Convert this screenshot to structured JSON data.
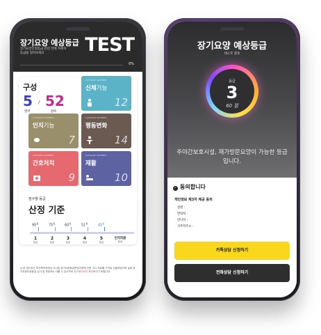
{
  "left": {
    "status_text": "9:41 KST",
    "header": {
      "title": "장기요양 예상등급",
      "description": "장기요양인정등급 관련 전에 자세히 등급을 알아보세요",
      "test_badge": "TEST",
      "progress": 0,
      "progress_label": "0%"
    },
    "composition": {
      "title": "구성",
      "count_a": "5",
      "count_a_label": "영역",
      "separator": "/",
      "count_b": "52",
      "count_b_label": "항목"
    },
    "tiles": [
      {
        "small": "CATEGORY NUMBER",
        "label_bold": "신체",
        "label_rest": "기능",
        "count": "12",
        "icon": "person-icon"
      },
      {
        "small": "CATEGORY NUMBER",
        "label_bold": "인지",
        "label_rest": "기능",
        "count": "7",
        "icon": "brain-icon"
      },
      {
        "small": "CATEGORY NUMBER",
        "label_bold": "행동변화",
        "label_rest": "",
        "count": "14",
        "icon": "activity-icon"
      },
      {
        "small": "CATEGORY NUMBER",
        "label_bold": "간호처치",
        "label_rest": "",
        "count": "9",
        "icon": "medical-kit-icon"
      },
      {
        "small": "CATEGORY NUMBER",
        "label_bold": "재활",
        "label_rest": "",
        "count": "10",
        "icon": "rehab-icon"
      }
    ],
    "criteria": {
      "small_label": "점수별 등급",
      "title": "산정 기준",
      "thresholds": [
        {
          "value": "95",
          "unit": "점"
        },
        {
          "value": "75",
          "unit": "점"
        },
        {
          "value": "60",
          "unit": "점"
        },
        {
          "value": "51",
          "unit": "점"
        },
        {
          "value": "45",
          "unit": "점"
        }
      ],
      "grades": [
        {
          "num": "1",
          "unit": "등급"
        },
        {
          "num": "2",
          "unit": "등급"
        },
        {
          "num": "3",
          "unit": "등급"
        },
        {
          "num": "4",
          "unit": "등급"
        },
        {
          "num": "5",
          "unit": "등급"
        },
        {
          "num": "인지지원",
          "unit": "등급"
        }
      ]
    },
    "footer_note_a": "※ 본 테스트는 보건복지부에서 고시한 장기요양등급판정기준에 관한 고시 자료를 근거로 산출하였으며 실제 장기요양인정등급 심사 및 판정과는 다를 수 있으므로",
    "footer_note_hl": "참고용으로만 확인",
    "footer_note_b": "하시기 바랍니다."
  },
  "right": {
    "status_text": "9:41 KST",
    "title": "장기요양 예상등급",
    "subtitle": "테스트 결과",
    "grade_label": "등급",
    "grade_value": "3",
    "points": "60 점",
    "result_text": "주야간보호시설, 재가방문요양이 가능한 등급입니다.",
    "agree_label": "동의합니다",
    "consent_title": "개인정보 제3자 제공 동의",
    "fields": [
      "성명 :",
      "연락처 :",
      "만나이 :",
      "거주지주소 :"
    ],
    "kakao_button": "카톡상담 신청하기",
    "phone_button": "전화상담 신청하기"
  },
  "colors": {
    "composition_a": "#3d3fb5",
    "composition_b": "#c12a8e",
    "kakao": "#f9d71c"
  }
}
